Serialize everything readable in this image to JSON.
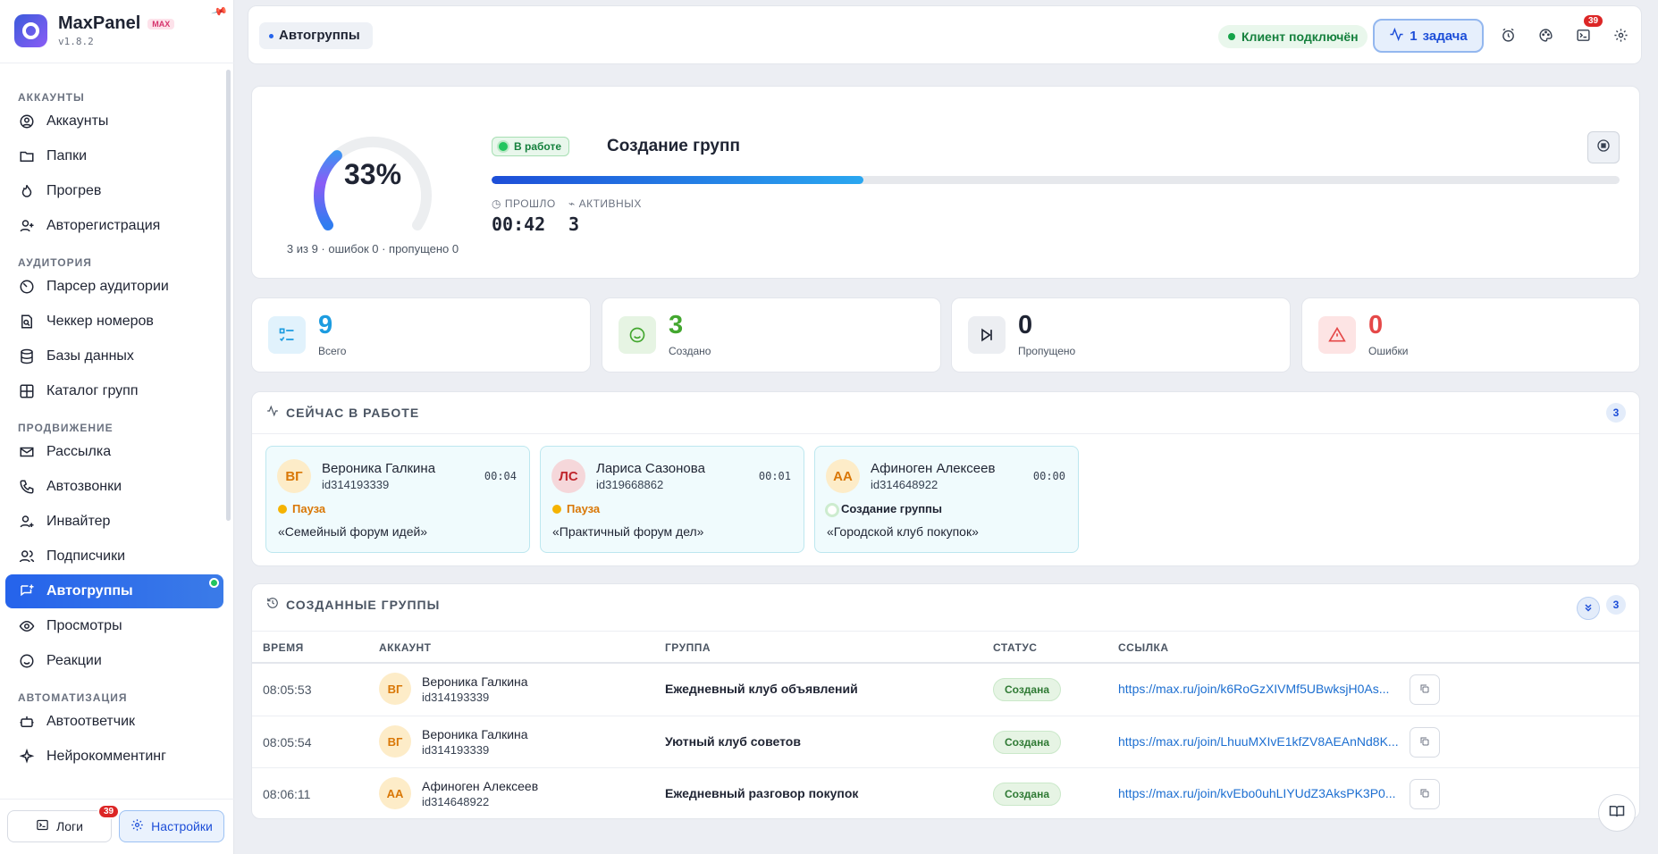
{
  "app": {
    "name": "MaxPanel",
    "tag": "MAX",
    "version": "v1.8.2"
  },
  "sidebar": {
    "sections": [
      {
        "title": "АККАУНТЫ",
        "items": [
          {
            "label": "Аккаунты",
            "icon": "user-circle-icon"
          },
          {
            "label": "Папки",
            "icon": "folder-icon"
          },
          {
            "label": "Прогрев",
            "icon": "flame-icon"
          },
          {
            "label": "Авторегистрация",
            "icon": "user-plus-icon"
          }
        ]
      },
      {
        "title": "АУДИТОРИЯ",
        "items": [
          {
            "label": "Парсер аудитории",
            "icon": "timer-icon"
          },
          {
            "label": "Чеккер номеров",
            "icon": "file-search-icon"
          },
          {
            "label": "Базы данных",
            "icon": "database-icon"
          },
          {
            "label": "Каталог групп",
            "icon": "grid-icon"
          }
        ]
      },
      {
        "title": "ПРОДВИЖЕНИЕ",
        "items": [
          {
            "label": "Рассылка",
            "icon": "mail-icon"
          },
          {
            "label": "Автозвонки",
            "icon": "phone-icon"
          },
          {
            "label": "Инвайтер",
            "icon": "user-add-icon"
          },
          {
            "label": "Подписчики",
            "icon": "users-icon"
          },
          {
            "label": "Автогруппы",
            "icon": "message-plus-icon",
            "active": true
          },
          {
            "label": "Просмотры",
            "icon": "eye-icon"
          },
          {
            "label": "Реакции",
            "icon": "smile-icon"
          }
        ]
      },
      {
        "title": "АВТОМАТИЗАЦИЯ",
        "items": [
          {
            "label": "Автоответчик",
            "icon": "bot-icon"
          },
          {
            "label": "Нейрокомментинг",
            "icon": "spark-icon"
          }
        ]
      }
    ],
    "footer": {
      "logs_label": "Логи",
      "logs_badge": "39",
      "settings_label": "Настройки"
    }
  },
  "topbar": {
    "breadcrumb": "Автогруппы",
    "connection": "Клиент подключён",
    "task_count": "1",
    "task_label": "задача",
    "terminal_badge": "39"
  },
  "progress": {
    "percent_text": "33%",
    "percent": 33,
    "caption": "3 из 9 · ошибок 0 · пропущено 0",
    "status": "В работе",
    "title": "Создание групп",
    "elapsed_label": "ПРОШЛО",
    "elapsed": "00:42",
    "active_label": "АКТИВНЫХ",
    "active": "3"
  },
  "stats": [
    {
      "value": "9",
      "label": "Всего",
      "color": "#1c9ce0",
      "bg": "#e1f2fc",
      "icon": "list-check-icon"
    },
    {
      "value": "3",
      "label": "Создано",
      "color": "#43a72f",
      "bg": "#e6f4e3",
      "icon": "smile-face-icon"
    },
    {
      "value": "0",
      "label": "Пропущено",
      "color": "#1f2433",
      "bg": "#eceef2",
      "icon": "skip-icon"
    },
    {
      "value": "0",
      "label": "Ошибки",
      "color": "#e54848",
      "bg": "#fde4e4",
      "icon": "warning-icon"
    }
  ],
  "working": {
    "title": "СЕЙЧАС В РАБОТЕ",
    "count": "3",
    "cards": [
      {
        "initials": "ВГ",
        "name": "Вероника Галкина",
        "id": "id314193339",
        "time": "00:04",
        "state": "Пауза",
        "group": "«Семейный форум идей»"
      },
      {
        "initials": "ЛС",
        "name": "Лариса Сазонова",
        "id": "id319668862",
        "time": "00:01",
        "state": "Пауза",
        "group": "«Практичный форум дел»"
      },
      {
        "initials": "АА",
        "name": "Афиноген Алексеев",
        "id": "id314648922",
        "time": "00:00",
        "state": "Создание группы",
        "group": "«Городской клуб покупок»"
      }
    ]
  },
  "created": {
    "title": "СОЗДАННЫЕ ГРУППЫ",
    "count": "3",
    "columns": [
      "ВРЕМЯ",
      "АККАУНТ",
      "ГРУППА",
      "СТАТУС",
      "ССЫЛКА"
    ],
    "rows": [
      {
        "time": "08:05:53",
        "initials": "ВГ",
        "name": "Вероника Галкина",
        "id": "id314193339",
        "group": "Ежедневный клуб объявлений",
        "status": "Создана",
        "link": "https://max.ru/join/k6RoGzXIVMf5UBwksjH0As..."
      },
      {
        "time": "08:05:54",
        "initials": "ВГ",
        "name": "Вероника Галкина",
        "id": "id314193339",
        "group": "Уютный клуб советов",
        "status": "Создана",
        "link": "https://max.ru/join/LhuuMXIvE1kfZV8AEAnNd8K..."
      },
      {
        "time": "08:06:11",
        "initials": "АА",
        "name": "Афиноген Алексеев",
        "id": "id314648922",
        "group": "Ежедневный разговор покупок",
        "status": "Создана",
        "link": "https://max.ru/join/kvEbo0uhLIYUdZ3AksPK3P0..."
      }
    ]
  }
}
